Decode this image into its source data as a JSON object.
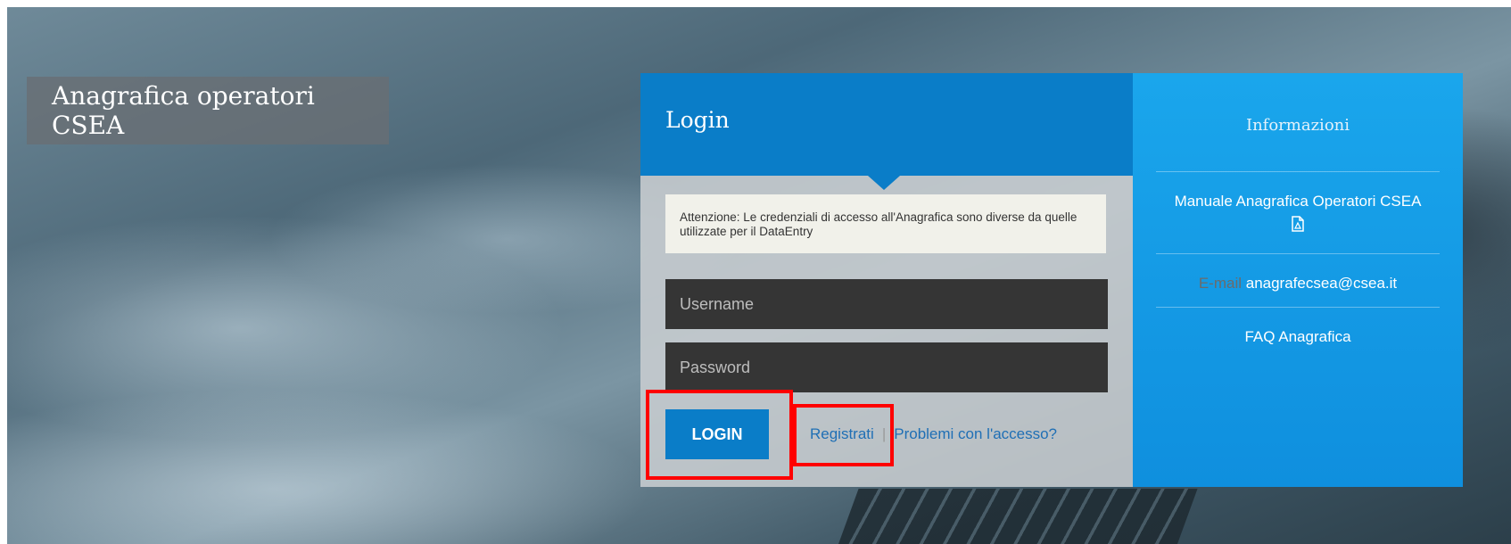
{
  "header": {
    "title": "Anagrafica operatori CSEA"
  },
  "login": {
    "title": "Login",
    "notice_bold": "Attenzione",
    "notice_text": ": Le credenziali di accesso all'Anagrafica sono diverse da quelle utilizzate per il DataEntry",
    "username_placeholder": "Username",
    "password_placeholder": "Password",
    "login_button": "LOGIN",
    "register_link": "Registrati",
    "separator": "|",
    "help_link": "Problemi con l'accesso?"
  },
  "info": {
    "title": "Informazioni",
    "manual_link": "Manuale Anagrafica Operatori CSEA",
    "manual_icon": "pdf-icon",
    "email_label": "E-mail",
    "email_value": "anagrafecsea@csea.it",
    "faq_link": "FAQ Anagrafica"
  },
  "colors": {
    "primary_blue": "#0a7dc8",
    "info_blue": "#1aa6ec",
    "highlight_red": "#ff0000",
    "field_dark": "#353535"
  }
}
